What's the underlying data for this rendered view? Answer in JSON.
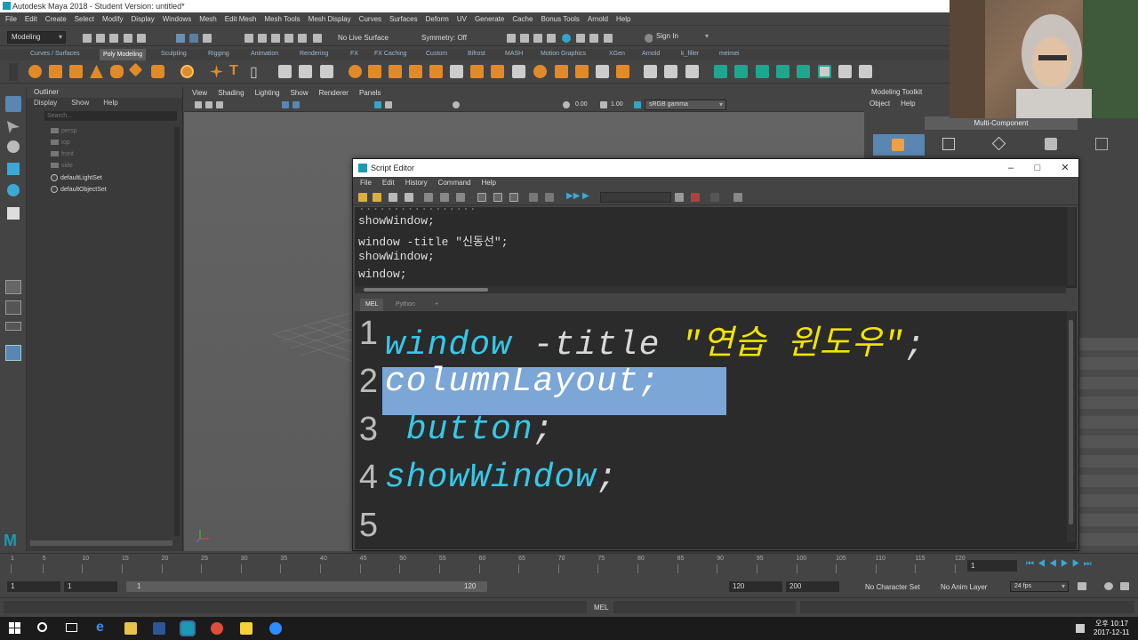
{
  "window": {
    "title": "Autodesk Maya 2018 - Student Version: untitled*"
  },
  "menubar": [
    "File",
    "Edit",
    "Create",
    "Select",
    "Modify",
    "Display",
    "Windows",
    "Mesh",
    "Edit Mesh",
    "Mesh Tools",
    "Mesh Display",
    "Curves",
    "Surfaces",
    "Deform",
    "UV",
    "Generate",
    "Cache",
    "Bonus Tools",
    "Arnold",
    "Help"
  ],
  "statusline": {
    "mode": "Modeling",
    "live_surface": "No Live Surface",
    "symmetry": "Symmetry: Off",
    "signin": "Sign In"
  },
  "shelf_tabs": [
    "Curves / Surfaces",
    "Poly Modeling",
    "Sculpting",
    "Rigging",
    "Animation",
    "Rendering",
    "FX",
    "FX Caching",
    "Custom",
    "Bifrost",
    "MASH",
    "Motion Graphics",
    "XGen",
    "Arnold",
    "k_filler",
    "meimei"
  ],
  "shelf_active": "Poly Modeling",
  "outliner": {
    "title": "Outliner",
    "menu": [
      "Display",
      "Show",
      "Help"
    ],
    "search_placeholder": "Search...",
    "items": [
      "persp",
      "top",
      "front",
      "side",
      "defaultLightSet",
      "defaultObjectSet"
    ]
  },
  "viewport": {
    "menu": [
      "View",
      "Shading",
      "Lighting",
      "Show",
      "Renderer",
      "Panels"
    ],
    "value1": "0.00",
    "value2": "1.00",
    "colorspace": "sRGB gamma"
  },
  "modeling_toolkit": {
    "title": "Modeling Toolkit",
    "menu": [
      "Object",
      "Help"
    ],
    "multi_component": "Multi-Component"
  },
  "script_editor": {
    "title": "Script Editor",
    "menu": [
      "File",
      "Edit",
      "History",
      "Command",
      "Help"
    ],
    "history": [
      "showWindow;",
      "window -title \"신동선\";",
      "showWindow;",
      "window;"
    ],
    "tabs": [
      "MEL",
      "Python",
      "+"
    ],
    "code_lines": [
      {
        "num": "1",
        "parts": [
          {
            "text": "window",
            "color": "#37c8e8"
          },
          {
            "text": " -title ",
            "color": "#d9d9d9"
          },
          {
            "text": "\"연습 윈도우\"",
            "color": "#f2e400"
          },
          {
            "text": ";",
            "color": "#d9d9d9"
          }
        ]
      },
      {
        "num": "2",
        "parts": [
          {
            "text": "columnLayout;",
            "color": "#ffffff"
          }
        ],
        "selected": true
      },
      {
        "num": "3",
        "parts": [
          {
            "text": " button",
            "color": "#37c8e8"
          },
          {
            "text": ";",
            "color": "#d9d9d9"
          }
        ]
      },
      {
        "num": "4",
        "parts": [
          {
            "text": "showWindow",
            "color": "#37c8e8"
          },
          {
            "text": ";",
            "color": "#d9d9d9"
          }
        ]
      },
      {
        "num": "5",
        "parts": []
      }
    ]
  },
  "timeslider": {
    "ticks": [
      "1",
      "5",
      "10",
      "15",
      "20",
      "25",
      "30",
      "35",
      "40",
      "45",
      "50",
      "55",
      "60",
      "65",
      "70",
      "75",
      "80",
      "85",
      "90",
      "95",
      "100",
      "105",
      "110",
      "115",
      "120"
    ],
    "current_frame": "1"
  },
  "rangeslider": {
    "start": "1",
    "start2": "1",
    "range_start": "1",
    "range_end": "120",
    "end": "120",
    "end2": "200",
    "character_set": "No Character Set",
    "anim_layer": "No Anim Layer",
    "fps": "24 fps"
  },
  "cmdline": {
    "lang": "MEL"
  },
  "taskbar": {
    "time": "오후 10:17",
    "date": "2017-12-11"
  },
  "colors": {
    "code_bg": "#2b2b2b",
    "selection": "#7ba6d6",
    "keyword": "#37c8e8",
    "string": "#f2e400",
    "maya_teal": "#1a9bb3"
  }
}
